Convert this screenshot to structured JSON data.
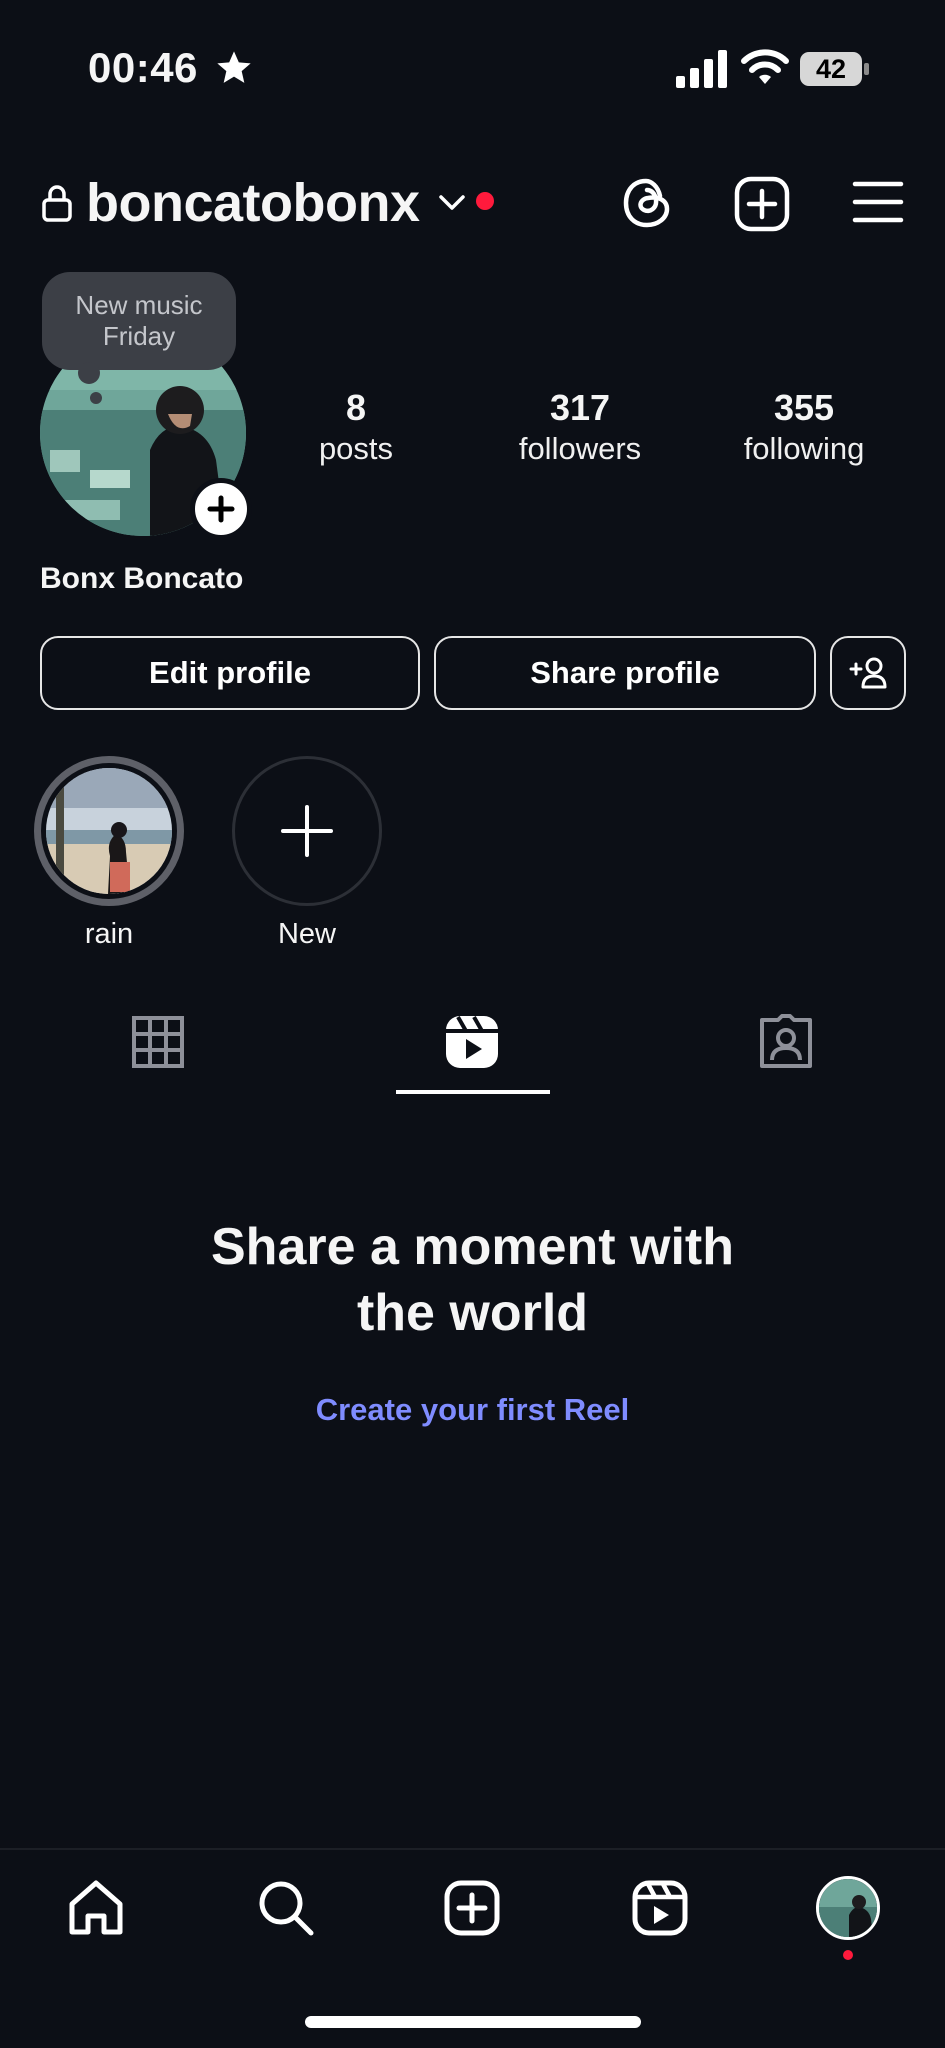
{
  "status_bar": {
    "time": "00:46",
    "battery": "42"
  },
  "header": {
    "username": "boncatobonx"
  },
  "profile": {
    "note": "New music Friday",
    "stats": [
      {
        "value": "8",
        "label": "posts"
      },
      {
        "value": "317",
        "label": "followers"
      },
      {
        "value": "355",
        "label": "following"
      }
    ],
    "display_name": "Bonx Boncato"
  },
  "actions": {
    "edit": "Edit profile",
    "share": "Share profile"
  },
  "highlights": [
    {
      "label": "rain"
    },
    {
      "label": "New"
    }
  ],
  "empty_state": {
    "title": "Share a moment with the world",
    "link": "Create your first Reel"
  },
  "colors": {
    "background": "#0c0f16",
    "link": "#7f8cff",
    "notification": "#ff1a3c"
  }
}
